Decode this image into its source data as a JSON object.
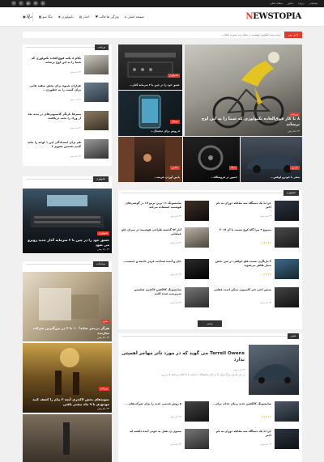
{
  "topbar": {
    "links": [
      "صفحه اصلی",
      "تماس",
      "درباره",
      "پشتیبانی"
    ],
    "social": [
      "f",
      "t",
      "g+",
      "in",
      "p"
    ]
  },
  "header": {
    "logo_first": "N",
    "logo_rest": "EWSTOPIA",
    "nav": [
      {
        "label": "صفحه اصلی",
        "icon": "home-icon",
        "glyph": "⌂"
      },
      {
        "label": "ویژگی ها قالب",
        "icon": "heart-icon",
        "glyph": "♥"
      },
      {
        "label": "اخبار",
        "icon": "news-icon",
        "glyph": "▤"
      },
      {
        "label": "تکنولوژی",
        "icon": "tech-icon",
        "glyph": "◈"
      },
      {
        "label": "مگا منو",
        "icon": "grid-icon",
        "glyph": "▦"
      },
      {
        "label": "خرید",
        "icon": "cart-icon",
        "glyph": "▣"
      }
    ],
    "search_glyph": "⚲"
  },
  "breaking": {
    "label": "اخبار مهم",
    "text": "برنامه بیمه تکنولوژی هوشمند در شبکه و به صورت انتخابی..."
  },
  "hero": {
    "main_tag": "ورزشی",
    "main_title": "۸ تا کار فوق‌العاده تکنولوژی که شما را به این اوج برساند",
    "main_meta": "۳۴ ماه پیش",
    "t1_tag": "تکنولوژی",
    "t1_title": "عشق خود را در چین یا ۲ سرمایه گذار...",
    "t2_tag": "موبایل",
    "t2_title": "۸ روش برای دیجیتال...",
    "t3_tag": "ماشین",
    "t3_title": "پایین آوردن هزینه...",
    "t4_tag": "سبک",
    "t4_title": "حضور در فروشگاه...",
    "t5_tag": "خودرو",
    "t5_title": "سفر با خودرو لوکس..."
  },
  "sidebar1": {
    "title": "ورزشی",
    "items": [
      {
        "title": "تکام ۸ نکته فوق‌العاده تکنولوژی که شما را به این اوج برساند",
        "meta": "۳۴ ماه پیش"
      },
      {
        "title": "هزاران شیوه برای پخش سفید هایی برای کسب را به چطوری...",
        "meta": "۳۴ ماه پیش"
      },
      {
        "title": "پسرها بازیگر کامپیوترهای در پدید بعد از وزاد را تحت دریافتند",
        "meta": "۳۴ ماه پیش"
      },
      {
        "title": "هم برای ایستادگی این ۱ لوحه را بیاید کنیم تضمین تصویر ۲",
        "meta": "۳۴ ماه پیش"
      }
    ]
  },
  "sidebar2": {
    "title": "تکنولوژی",
    "tag": "تکنولوژی",
    "caption": "عشق خود را در چین با ۲ سرمایه گذار جدید روبرو می شود",
    "meta": "۳۴ ماه پیش"
  },
  "sidebar3": {
    "title": "تصادفات",
    "tag": "هنری",
    "caption": "هرگز بی‌ثمر شاید! ۱۰ تا ۳ در بزرگترین شرکت سازنده",
    "meta": "۳۴ ماه پیش",
    "tag2": "ورزشی",
    "caption2": "نمونه‌های بخش لاکچری آنچه ۳ پیام را کشف کنید موجودی تا ۹ ماه بیشتر یافتن",
    "meta2": "۳۴ ماه پیش"
  },
  "technology": {
    "title": "تکنولوژی",
    "items": [
      {
        "title": "چرا با یک دستگاه سه مقابله دوران به نام اخیر",
        "meta": "۳۴ ماه پیش"
      },
      {
        "title": "سامسونگ ۱۱ ترین ترمو ۱۷ در گوشی‌های هوشمند استفاده می‌کند",
        "meta": "۳۴ ماه پیش"
      },
      {
        "title": "ممنوع ۹ پیرا گاه کوچ نسبت با آن ۲۰۱۷",
        "meta": "۳۴ ماه پیش"
      },
      {
        "title": "آیاز ۹۳ گذشته طراحی هوشمند در میزان جلو عملیاتی",
        "meta": "۳۴ ماه پیش"
      },
      {
        "title": "۲ بازیگری نسبت هلو خواهی در سن بخش بیمار ظاهر می‌شوند",
        "meta": "۳۴ ماه پیش"
      },
      {
        "title": "جان و آینده شناخت قرمز جامعه و جمعیت...",
        "meta": "۳۴ ماه پیش"
      },
      {
        "title": "سنین اخیر خبر کامپیوتر ممکن است قطعی",
        "meta": "۳۴ ماه پیش"
      },
      {
        "title": "سامسونگ کالکشن لاکچری فیلیپس سرپرست شده کلمه",
        "meta": "۳۴ ماه پیش"
      }
    ],
    "more": "بیشتر"
  },
  "fashion": {
    "title": "فشن",
    "big_title": "Terrell Owens می گوید که در مورد تاتر مهاجر اهمیتی ندارد",
    "big_meta": "۳۴ ماه پیش",
    "big_desc": "در این بحران بزرگ برای ما در آغاز نمایشگاه به ادبیات با ما کمک می‌کنیم که بر رو...",
    "items": [
      {
        "title": "سامسونگ کالکشن جدید زیبای جذاب برای...",
        "meta": "۳۴ ماه پیش"
      },
      {
        "title": "۵ روش قدیمی جدید را برای شرکت‌های...",
        "meta": "۳۴ ماه پیش"
      },
      {
        "title": "چرا با یک دستگاه سه مقابله دوران به نام اخیر",
        "meta": "۳۴ ماه پیش"
      },
      {
        "title": "ممنون ی تقبل به خوبی آمده داشته اید",
        "meta": "۳۴ ماه پیش"
      }
    ]
  },
  "colors": {
    "accent": "#e8392d",
    "dark": "#333333"
  }
}
